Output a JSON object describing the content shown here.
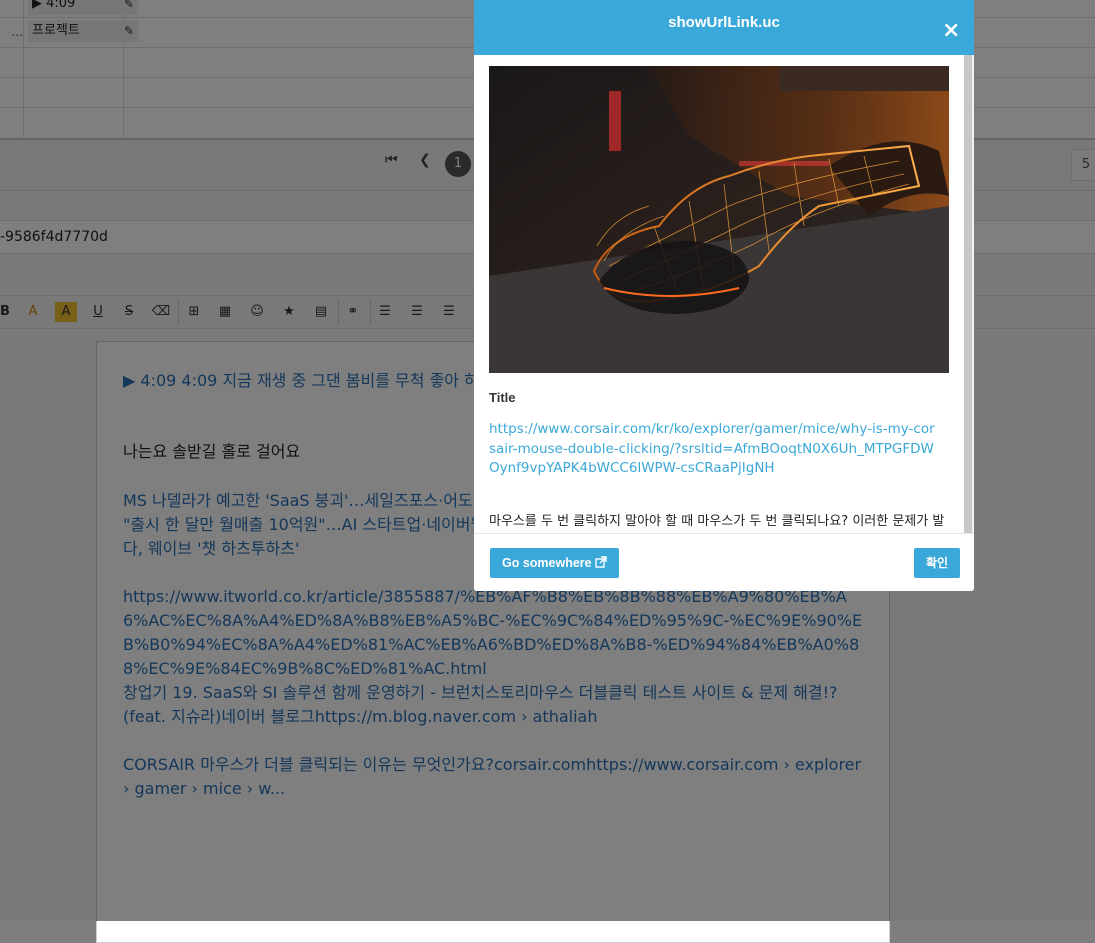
{
  "background": {
    "grid": {
      "row_dots": "...",
      "chip_top": "▶ 4:09",
      "chip_project": "프로젝트"
    },
    "pager": {
      "first_icon": "first-page-icon",
      "prev_icon": "prev-page-icon",
      "current_page": "1",
      "last_visible_page": "5"
    },
    "id_text": "-9586f4d7770d",
    "toolbar": {
      "bold": "B",
      "font_color": "A",
      "bg_color": "A",
      "underline": "U",
      "strike": "S"
    },
    "editor": {
      "line1": "▶ 4:09 4:09 지금 재생 중 그댄 봄비를 무척 좋아 하나요",
      "line2": "나는요 솔받길 홀로 걸어요",
      "line3": "MS 나델라가 예고한 'SaaS 붕괴'…세일즈포스·어도비…",
      "line4": "\"출시 한 달만 월매출 10억원\"…AI 스타트업·네이버웹…",
      "line5": "다, 웨이브 '챗 하츠투하츠'",
      "line6": "https://www.itworld.co.kr/article/3855887/%EB%AF%B8%EB%8B%88%EB%A9%80%EB%A6%AC%EC%8A%A4%ED%8A%B8%EB%A5%BC-%EC%9C%84%ED%95%9C-%EC%9E%90%EB%B0%94%EC%8A%A4%ED%81%AC%EB%A6%BD%ED%8A%B8-%ED%94%84%EB%A0%88%EC%9E%84EC%9B%8C%ED%81%AC.html",
      "line7": "창업기 19. SaaS와 SI 솔루션 함께 운영하기 - 브런치스토리마우스 더블클릭 테스트 사이트 & 문제 해결!? (feat. 지슈라)네이버 블로그https://m.blog.naver.com › athaliah",
      "line8": "CORSAIR 마우스가 더블 클릭되는 이유는 무엇인가요?corsair.comhttps://www.corsair.com › explorer › gamer › mice › w..."
    }
  },
  "modal": {
    "title": "showUrlLink.uc",
    "close_glyph": "×",
    "og_title": "Title",
    "og_url": "https://www.corsair.com/kr/ko/explorer/gamer/mice/why-is-my-corsair-mouse-double-clicking/?srsltid=AfmBOoqtN0X6Uh_MTPGFDWOynf9vpYAPK4bWCC6lWPW-csCRaaPjIgNH",
    "og_desc": "마우스를 두 번 클릭하지 말아야 할 때 마우스가 두 번 클릭되나요? 이러한 문제가 발",
    "go_button": "Go somewhere",
    "go_icon": "external-link-icon",
    "ok_button": "확인"
  },
  "colors": {
    "accent": "#3aa8d8",
    "overlay": "rgba(0,0,0,0.5)"
  }
}
